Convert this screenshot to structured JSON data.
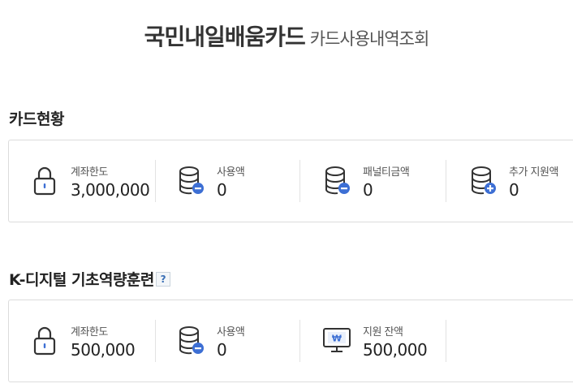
{
  "header": {
    "title": "국민내일배움카드",
    "subtitle": "카드사용내역조회"
  },
  "card_status": {
    "title": "카드현황",
    "items": [
      {
        "label": "계좌한도",
        "value": "3,000,000",
        "icon": "lock-icon"
      },
      {
        "label": "사용액",
        "value": "0",
        "icon": "coins-minus-icon"
      },
      {
        "label": "패널티금액",
        "value": "0",
        "icon": "coins-minus-icon"
      },
      {
        "label": "추가 지원액",
        "value": "0",
        "icon": "coins-plus-icon"
      }
    ]
  },
  "k_digital": {
    "title": "K-디지털 기초역량훈련",
    "help_label": "?",
    "items": [
      {
        "label": "계좌한도",
        "value": "500,000",
        "icon": "lock-icon"
      },
      {
        "label": "사용액",
        "value": "0",
        "icon": "coins-minus-icon"
      },
      {
        "label": "지원 잔액",
        "value": "500,000",
        "icon": "monitor-won-icon"
      }
    ]
  },
  "colors": {
    "accent": "#3d6fd4",
    "icon_stroke": "#333333",
    "border": "#dcdcdc"
  }
}
